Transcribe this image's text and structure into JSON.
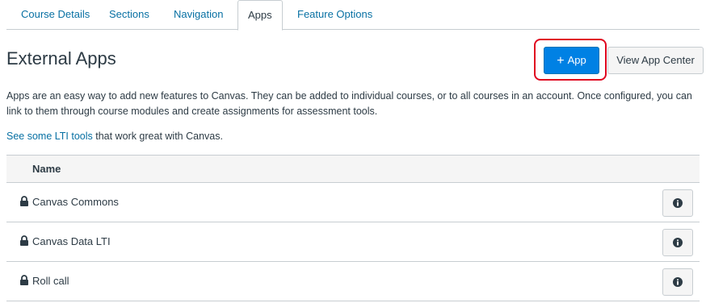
{
  "tabs": [
    {
      "label": "Course Details"
    },
    {
      "label": "Sections"
    },
    {
      "label": "Navigation"
    },
    {
      "label": "Apps",
      "active": true
    },
    {
      "label": "Feature Options"
    }
  ],
  "page_title": "External Apps",
  "buttons": {
    "add_app_plus": "+",
    "add_app_label": "App",
    "view_app_center": "View App Center"
  },
  "description": "Apps are an easy way to add new features to Canvas. They can be added to individual courses, or to all courses in an account. Once configured, you can link to them through course modules and create assignments for assessment tools.",
  "lti": {
    "link_text": "See some LTI tools",
    "trailing_text": " that work great with Canvas."
  },
  "table": {
    "header_name": "Name",
    "rows": [
      {
        "name": "Canvas Commons",
        "icon": "lock-icon",
        "action_icon": "info-icon"
      },
      {
        "name": "Canvas Data LTI",
        "icon": "lock-icon",
        "action_icon": "info-icon"
      },
      {
        "name": "Roll call",
        "icon": "lock-icon",
        "action_icon": "info-icon"
      }
    ]
  },
  "colors": {
    "link": "#0770a3",
    "primary_button": "#0081e4",
    "highlight_border": "#e0061f",
    "text": "#2d3b45"
  }
}
